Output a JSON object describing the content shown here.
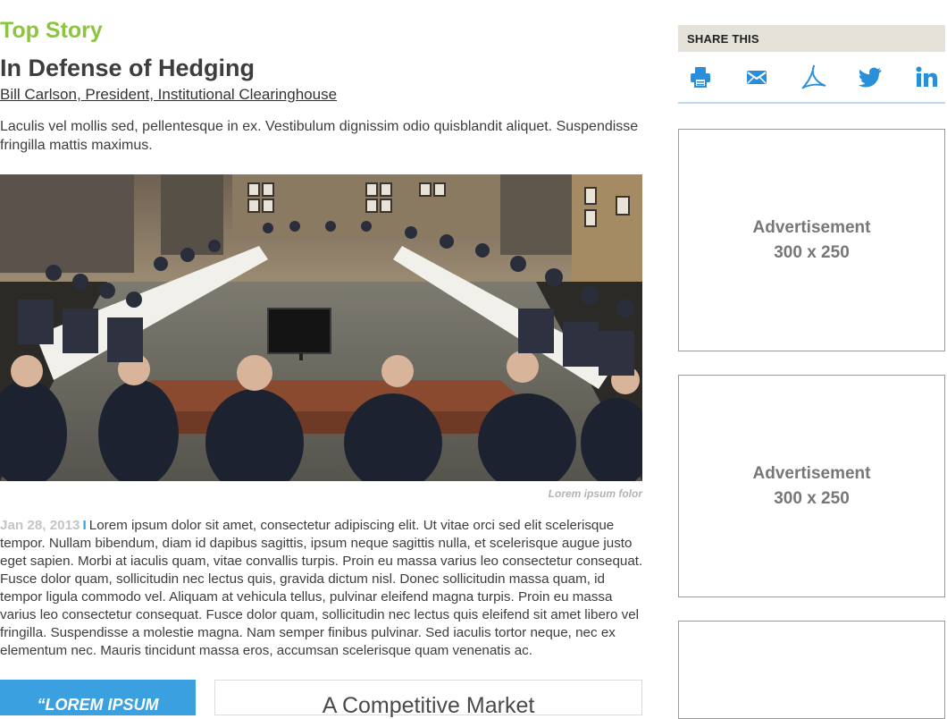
{
  "article": {
    "section_label": "Top Story",
    "headline": "In Defense of Hedging",
    "byline": "Bill Carlson, President, Institutional Clearinghouse",
    "dek": "Laculis vel mollis sed, pellentesque in ex. Vestibulum dignissim odio quisblandit aliquet. Suspendisse fringilla mattis maximus.",
    "image_caption": "Lorem ipsum folor",
    "date": "Jan 28, 2013",
    "separator": "I",
    "body": "Lorem ipsum dolor sit amet, consectetur adipiscing elit. Ut vitae orci sed elit scelerisque tempor. Nullam bibendum, diam id dapibus sagittis, ipsum neque sagittis nulla, et scelerisque augue justo eget sapien. Morbi at iaculis quam, vitae convallis turpis. Proin eu massa varius leo consectetur consequat. Fusce dolor quam, sollicitudin nec lectus quis, gravida dictum nisl. Donec sollicitudin massa quam, id tempor ligula commodo vel. Aliquam at vehicula tellus, pulvinar eleifend magna turpis. Proin eu massa varius leo consectetur consequat. Fusce dolor quam, sollicitudin nec lectus quis eleifend sit amet libero vel fringilla. Suspendisse a molestie magna. Nam semper finibus pulvinar. Sed iaculis tortor neque, nec ex elementum nec. Mauris tincidunt massa eros, accumsan scelerisque quam venenatis ac."
  },
  "quote_box": {
    "text": "“LOREM IPSUM"
  },
  "promo_box": {
    "title": "A Competitive Market"
  },
  "share": {
    "header": "SHARE THIS",
    "icons": [
      "printer-icon",
      "email-icon",
      "pdf-icon",
      "twitter-icon",
      "linkedin-icon"
    ]
  },
  "ads": [
    {
      "label": "Advertisement",
      "size": "300 x 250"
    },
    {
      "label": "Advertisement",
      "size": "300 x 250"
    },
    {
      "label": "",
      "size": ""
    }
  ],
  "colors": {
    "accent_green": "#8cc63f",
    "accent_blue": "#3aa0e0",
    "share_header_bg": "#e5e2da",
    "icon_blue": "#2a8fd8"
  }
}
